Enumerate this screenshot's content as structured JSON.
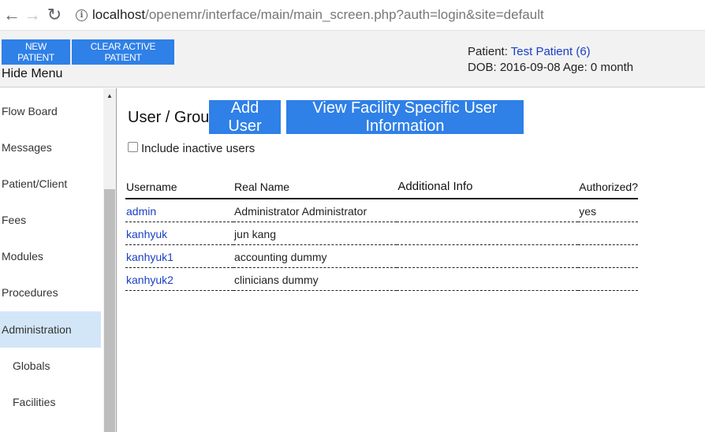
{
  "browser": {
    "url_host": "localhost",
    "url_path": "/openemr/interface/main/main_screen.php?auth=login&site=default"
  },
  "header": {
    "new_patient_label": "NEW PATIENT",
    "clear_patient_label": "CLEAR ACTIVE PATIENT",
    "hide_menu_label": "Hide Menu",
    "patient_prefix": "Patient:",
    "patient_name": "Test Patient (6)",
    "dob_line": "DOB: 2016-09-08 Age: 0 month"
  },
  "sidebar": {
    "items": [
      {
        "label": "Flow Board"
      },
      {
        "label": "Messages"
      },
      {
        "label": "Patient/Client"
      },
      {
        "label": "Fees"
      },
      {
        "label": "Modules"
      },
      {
        "label": "Procedures"
      },
      {
        "label": "Administration",
        "active": true
      },
      {
        "label": "Globals"
      },
      {
        "label": "Facilities"
      }
    ]
  },
  "main": {
    "title": "User / Groups",
    "add_user_label": "Add User",
    "view_facility_label": "View Facility Specific User Information",
    "include_inactive_label": "Include inactive users",
    "include_inactive_checked": false,
    "columns": [
      "Username",
      "Real Name",
      "Additional Info",
      "Authorized?"
    ],
    "rows": [
      {
        "username": "admin",
        "real_name": "Administrator Administrator",
        "info": "",
        "authorized": "yes"
      },
      {
        "username": "kanhyuk",
        "real_name": "jun kang",
        "info": "",
        "authorized": ""
      },
      {
        "username": "kanhyuk1",
        "real_name": "accounting dummy",
        "info": "",
        "authorized": ""
      },
      {
        "username": "kanhyuk2",
        "real_name": "clinicians dummy",
        "info": "",
        "authorized": ""
      }
    ]
  },
  "colors": {
    "button_blue": "#2f80e7",
    "link_blue": "#1a3fc4",
    "active_menu": "#d3e6f8"
  },
  "icons": {
    "back": "arrow-left-icon",
    "forward": "arrow-right-icon",
    "reload": "reload-icon",
    "site_info": "info-icon",
    "scroll_up": "scroll-up-arrow-icon"
  }
}
